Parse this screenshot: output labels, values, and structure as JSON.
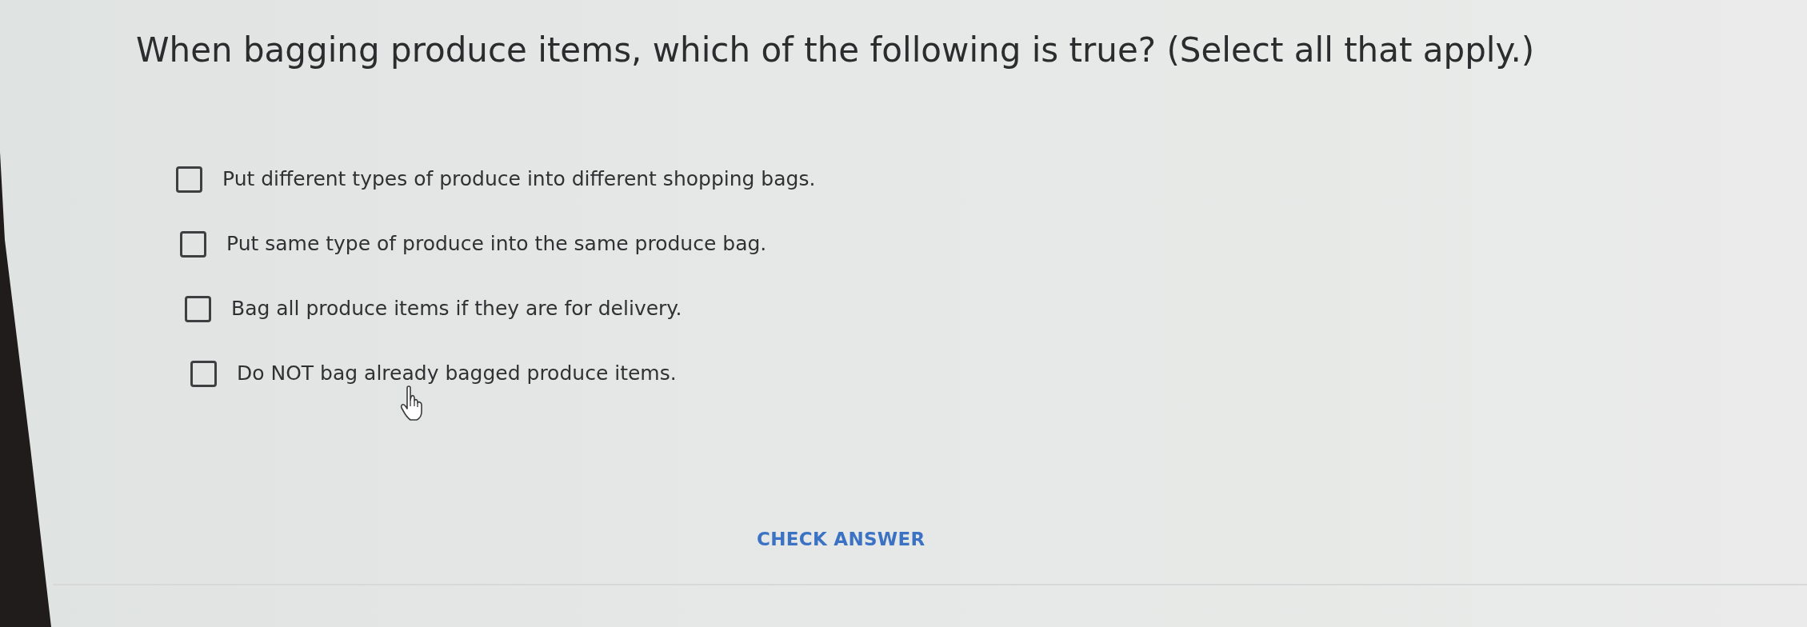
{
  "question": "When bagging produce items, which of the following is true? (Select all that apply.)",
  "options": [
    {
      "label": "Put different types of produce into different shopping bags.",
      "checked": false
    },
    {
      "label": "Put same type of produce into the same produce bag.",
      "checked": false
    },
    {
      "label": "Bag all produce items if they are for delivery.",
      "checked": false
    },
    {
      "label": "Do NOT bag already bagged produce items.",
      "checked": false
    }
  ],
  "check_button": {
    "label": "CHECK ANSWER"
  }
}
